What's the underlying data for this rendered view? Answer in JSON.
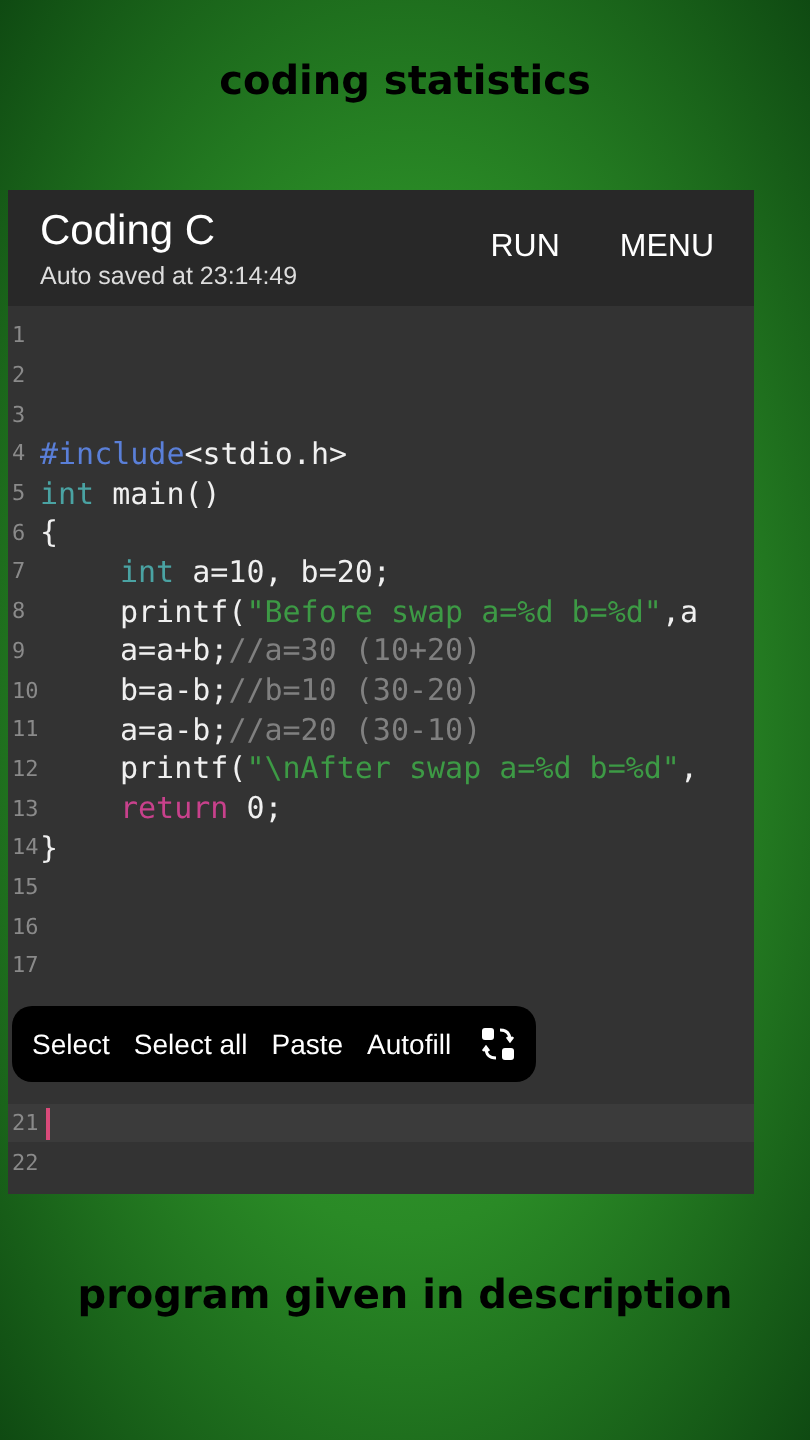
{
  "caption_top": "coding statistics",
  "app": {
    "title": "Coding C",
    "subtitle": "Auto saved at 23:14:49",
    "actions": [
      "RUN",
      "MENU"
    ]
  },
  "editor": {
    "lines": [
      {
        "number": "1",
        "current": false
      },
      {
        "number": "2",
        "current": false
      },
      {
        "number": "3",
        "current": false
      },
      {
        "number": "4",
        "current": false,
        "tokens": [
          {
            "kind": "preproc",
            "text": "#include"
          },
          {
            "kind": "plain",
            "text": "<stdio.h>"
          }
        ]
      },
      {
        "number": "5",
        "current": false,
        "tokens": [
          {
            "kind": "keyword",
            "text": "int"
          },
          {
            "kind": "plain",
            "text": " main()"
          }
        ]
      },
      {
        "number": "6",
        "current": false,
        "tokens": [
          {
            "kind": "plain",
            "text": "{"
          }
        ]
      },
      {
        "number": "7",
        "current": false,
        "indent": true,
        "tokens": [
          {
            "kind": "keyword",
            "text": "int"
          },
          {
            "kind": "plain",
            "text": " a=10, b=20;"
          }
        ]
      },
      {
        "number": "8",
        "current": false,
        "indent": true,
        "tokens": [
          {
            "kind": "plain",
            "text": "printf("
          },
          {
            "kind": "string",
            "text": "\"Before swap a=%d b=%d\""
          },
          {
            "kind": "plain",
            "text": ",a"
          }
        ]
      },
      {
        "number": "9",
        "current": false,
        "indent": true,
        "tokens": [
          {
            "kind": "plain",
            "text": "a=a+b;"
          },
          {
            "kind": "comment",
            "text": "//a=30 (10+20)"
          }
        ]
      },
      {
        "number": "10",
        "current": false,
        "indent": true,
        "tokens": [
          {
            "kind": "plain",
            "text": "b=a-b;"
          },
          {
            "kind": "comment",
            "text": "//b=10 (30-20)"
          }
        ]
      },
      {
        "number": "11",
        "current": false,
        "indent": true,
        "tokens": [
          {
            "kind": "plain",
            "text": "a=a-b;"
          },
          {
            "kind": "comment",
            "text": "//a=20 (30-10)"
          }
        ]
      },
      {
        "number": "12",
        "current": false,
        "indent": true,
        "tokens": [
          {
            "kind": "plain",
            "text": "printf("
          },
          {
            "kind": "string",
            "text": "\"\\nAfter swap a=%d b=%d\""
          },
          {
            "kind": "plain",
            "text": ","
          }
        ]
      },
      {
        "number": "13",
        "current": false,
        "indent": true,
        "tokens": [
          {
            "kind": "return",
            "text": "return"
          },
          {
            "kind": "plain",
            "text": " 0;"
          }
        ]
      },
      {
        "number": "14",
        "current": false,
        "tokens": [
          {
            "kind": "plain",
            "text": "}"
          }
        ]
      },
      {
        "number": "15",
        "current": false
      },
      {
        "number": "16",
        "current": false
      },
      {
        "number": "17",
        "current": false
      }
    ],
    "context_menu": {
      "items": [
        "Select",
        "Select all",
        "Paste",
        "Autofill"
      ]
    },
    "lines_below": [
      {
        "number": "21",
        "current": true
      },
      {
        "number": "22",
        "current": false
      }
    ]
  },
  "caption_bottom": "program given in description"
}
